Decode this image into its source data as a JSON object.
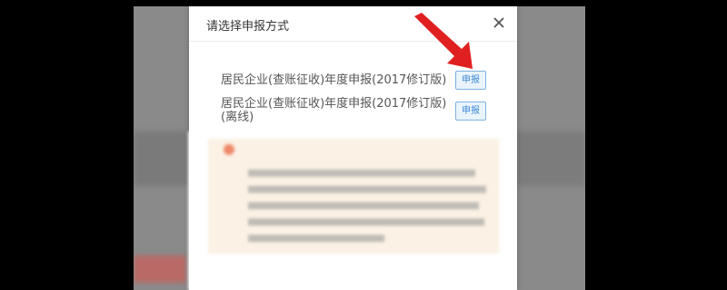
{
  "dialog": {
    "title": "请选择申报方式",
    "options": [
      {
        "label": "居民企业(查账征收)年度申报(2017修订版)",
        "button": "申报"
      },
      {
        "label": "居民企业(查账征收)年度申报(2017修订版)(离线)",
        "button": "申报"
      }
    ]
  },
  "icons": {
    "close": "close-icon",
    "arrow": "red-arrow-pointer",
    "warning": "warning-dot"
  },
  "colors": {
    "arrow": "#e02020",
    "button_border": "#7fb2e0",
    "notice_bg": "#fbf1e4"
  }
}
